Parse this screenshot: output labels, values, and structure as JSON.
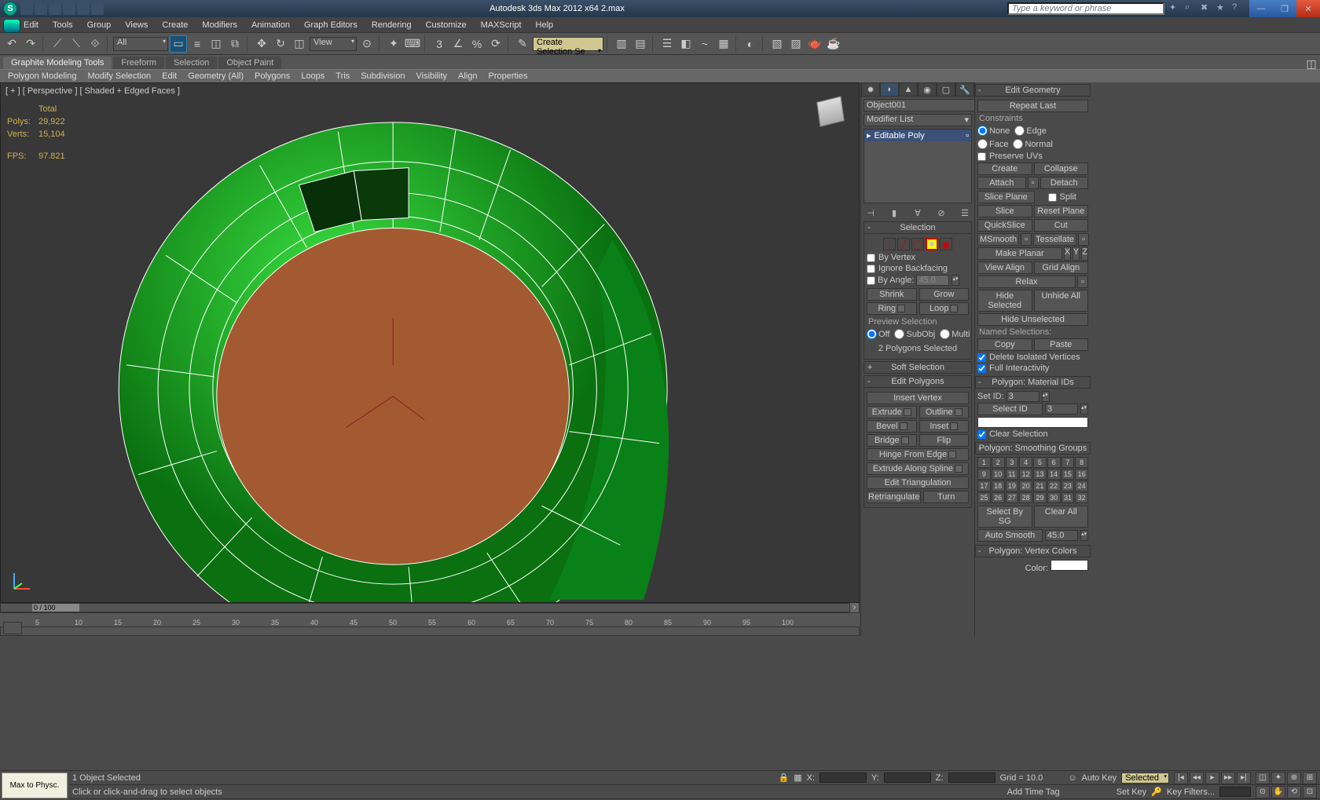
{
  "title": "Autodesk 3ds Max 2012 x64    2.max",
  "search_placeholder": "Type a keyword or phrase",
  "menu": [
    "Edit",
    "Tools",
    "Group",
    "Views",
    "Create",
    "Modifiers",
    "Animation",
    "Graph Editors",
    "Rendering",
    "Customize",
    "MAXScript",
    "Help"
  ],
  "toolbar_dropdown_all": "All",
  "toolbar_dropdown_view": "View",
  "selset_placeholder": "Create Selection Se",
  "ribbon_tabs": [
    "Graphite Modeling Tools",
    "Freeform",
    "Selection",
    "Object Paint"
  ],
  "sub_tabs": [
    "Polygon Modeling",
    "Modify Selection",
    "Edit",
    "Geometry (All)",
    "Polygons",
    "Loops",
    "Tris",
    "Subdivision",
    "Visibility",
    "Align",
    "Properties"
  ],
  "viewport_label": "[ + ] [ Perspective ] [ Shaded + Edged Faces ]",
  "stats": {
    "total": "Total",
    "polys_l": "Polys:",
    "polys": "29,922",
    "verts_l": "Verts:",
    "verts": "15,104",
    "fps_l": "FPS:",
    "fps": "97.821"
  },
  "timeline": {
    "pos": "0 / 100",
    "ticks": [
      "5",
      "10",
      "15",
      "20",
      "25",
      "30",
      "35",
      "40",
      "45",
      "50",
      "55",
      "60",
      "65",
      "70",
      "75",
      "80",
      "85",
      "90",
      "95",
      "100"
    ]
  },
  "cmd": {
    "object": "Object001",
    "modifier_list": "Modifier List",
    "stack_item": "Editable Poly",
    "selection_hdr": "Selection",
    "by_vertex": "By Vertex",
    "ignore_bf": "Ignore Backfacing",
    "by_angle": "By Angle:",
    "angle_val": "45.0",
    "shrink": "Shrink",
    "grow": "Grow",
    "ring": "Ring",
    "loop": "Loop",
    "preview": "Preview Selection",
    "off": "Off",
    "subobj": "SubObj",
    "multi": "Multi",
    "polysel": "2 Polygons Selected",
    "softsel": "Soft Selection",
    "editpoly_hdr": "Edit Polygons",
    "insvert": "Insert Vertex",
    "extrude": "Extrude",
    "outline": "Outline",
    "bevel": "Bevel",
    "inset": "Inset",
    "bridge": "Bridge",
    "flip": "Flip",
    "hingeedge": "Hinge From Edge",
    "extrudespl": "Extrude Along Spline",
    "edittri": "Edit Triangulation",
    "retri": "Retriangulate",
    "turn": "Turn"
  },
  "geo": {
    "hdr": "Edit Geometry",
    "repeat": "Repeat Last",
    "constraints": "Constraints",
    "none": "None",
    "edge": "Edge",
    "face": "Face",
    "normal": "Normal",
    "preserve": "Preserve UVs",
    "create": "Create",
    "collapse": "Collapse",
    "attach": "Attach",
    "detach": "Detach",
    "sliceplane": "Slice Plane",
    "split": "Split",
    "slice": "Slice",
    "resetplane": "Reset Plane",
    "quickslice": "QuickSlice",
    "cut": "Cut",
    "msmooth": "MSmooth",
    "tess": "Tessellate",
    "makeplanar": "Make Planar",
    "viewalign": "View Align",
    "gridalign": "Grid Align",
    "relax": "Relax",
    "hidesel": "Hide Selected",
    "unhideall": "Unhide All",
    "hideunsel": "Hide Unselected",
    "namedsel": "Named Selections:",
    "copy": "Copy",
    "paste": "Paste",
    "deliso": "Delete Isolated Vertices",
    "fullint": "Full Interactivity",
    "matids_hdr": "Polygon: Material IDs",
    "setid": "Set ID:",
    "setid_v": "3",
    "selectid": "Select ID",
    "selectid_v": "3",
    "clearsel": "Clear Selection",
    "sg_hdr": "Polygon: Smoothing Groups",
    "selbysg": "Select By SG",
    "clearall": "Clear All",
    "autosmooth": "Auto Smooth",
    "autosmooth_v": "45.0",
    "vc_hdr": "Polygon: Vertex Colors",
    "color": "Color:"
  },
  "status_row": {
    "selinfo": "1 Object Selected",
    "prompt": "Click or click-and-drag to select objects",
    "x": "X:",
    "y": "Y:",
    "z": "Z:",
    "grid": "Grid = 10.0",
    "addtag": "Add Time Tag",
    "autokey": "Auto Key",
    "selected": "Selected",
    "setkey": "Set Key",
    "keyfilters": "Key Filters..."
  },
  "maxphys": "Max to Physc."
}
